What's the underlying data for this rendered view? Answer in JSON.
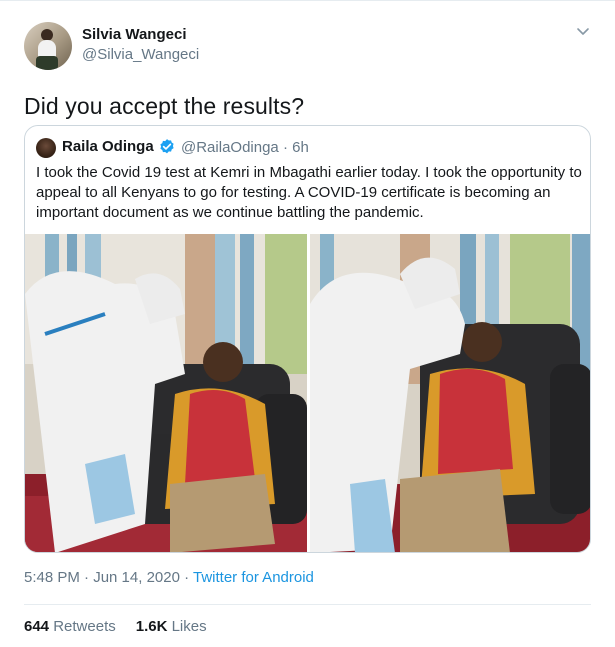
{
  "tweet": {
    "author_name": "Silvia Wangeci",
    "author_handle": "@Silvia_Wangeci",
    "text": "Did you accept the results?",
    "timestamp": "5:48 PM · Jun 14, 2020 · ",
    "source": "Twitter for Android",
    "retweet_count": "644",
    "retweet_label": "Retweets",
    "like_count": "1.6K",
    "like_label": "Likes"
  },
  "quoted": {
    "author_name": "Raila Odinga",
    "author_handle": "@RailaOdinga · 6h",
    "verified_icon": "verified-badge-icon",
    "text": "I took the Covid 19 test at Kemri in Mbagathi earlier today. I took the opportunity to appeal to all Kenyans to go for testing. A COVID-19 certificate is becoming an important document as we continue battling the pandemic."
  },
  "colors": {
    "text_primary": "#14171a",
    "text_secondary": "#657786",
    "link": "#1b95e0",
    "border": "#ccd6dd",
    "verified": "#1da1f2"
  }
}
